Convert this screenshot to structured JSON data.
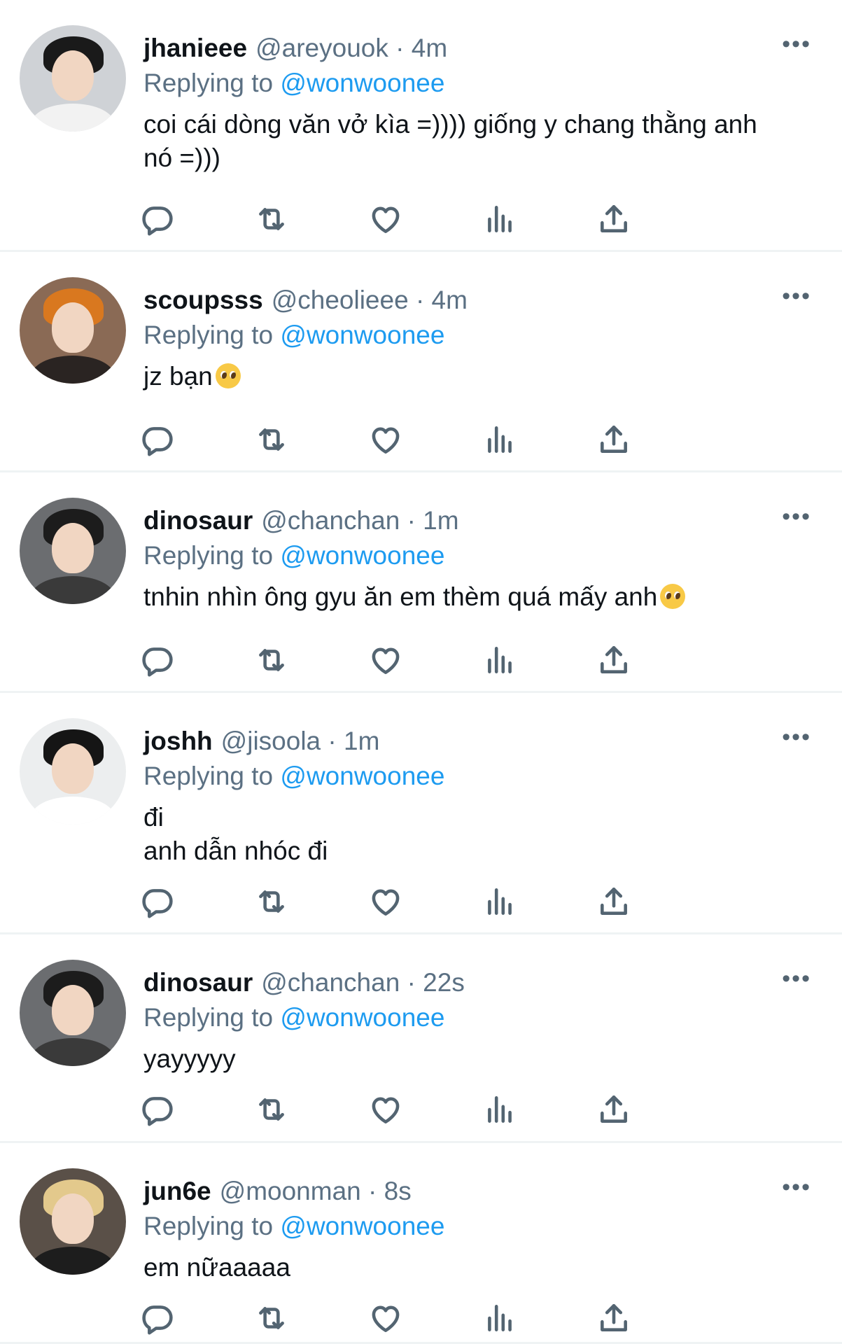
{
  "tweets": [
    {
      "name": "jhanieee",
      "handle": "@areyouok",
      "time": "· 4m",
      "replying_prefix": "Replying to",
      "mention": "@wonwoonee",
      "text": "coi cái dòng văn vở kìa =)))) giống y chang thằng anh\nnó =)))",
      "avatar": {
        "bg": "#cfd2d6",
        "hair": "#1a1a1a",
        "shirt": "#f2f2f2"
      }
    },
    {
      "name": "scoupsss",
      "handle": "@cheolieee",
      "time": "· 4m",
      "replying_prefix": "Replying to",
      "mention": "@wonwoonee",
      "text": "jz bạn",
      "emoji": "pleading-face",
      "avatar": {
        "bg": "#8a6a55",
        "hair": "#d9781f",
        "shirt": "#2a2422"
      }
    },
    {
      "name": "dinosaur",
      "handle": "@chanchan",
      "time": "· 1m",
      "replying_prefix": "Replying to",
      "mention": "@wonwoonee",
      "text": "tnhin nhìn ông gyu ăn em thèm quá mấy anh",
      "emoji": "pleading-face",
      "avatar": {
        "bg": "#6b6d70",
        "hair": "#1c1c1c",
        "shirt": "#3a3a3a"
      }
    },
    {
      "name": "joshh",
      "handle": "@jisoola",
      "time": "· 1m",
      "replying_prefix": "Replying to",
      "mention": "@wonwoonee",
      "text": "đi\nanh dẫn nhóc đi",
      "avatar": {
        "bg": "#eceeef",
        "hair": "#151515",
        "shirt": "#ffffff"
      }
    },
    {
      "name": "dinosaur",
      "handle": "@chanchan",
      "time": "· 22s",
      "replying_prefix": "Replying to",
      "mention": "@wonwoonee",
      "text": "yayyyyy",
      "avatar": {
        "bg": "#6b6d70",
        "hair": "#1c1c1c",
        "shirt": "#3a3a3a"
      }
    },
    {
      "name": "jun6e",
      "handle": "@moonman",
      "time": "· 8s",
      "replying_prefix": "Replying to",
      "mention": "@wonwoonee",
      "text": "em nữaaaaa",
      "avatar": {
        "bg": "#5a5048",
        "hair": "#e3c98c",
        "shirt": "#1d1d1d"
      }
    }
  ],
  "icons": {
    "more": "more-horizontal-icon",
    "reply": "reply-bubble-icon",
    "retweet": "retweet-icon",
    "like": "heart-icon",
    "views": "analytics-bars-icon",
    "share": "share-upload-icon"
  },
  "colors": {
    "link": "#1d9bf0",
    "secondary_text": "#5b7083",
    "divider": "#eff3f4"
  }
}
